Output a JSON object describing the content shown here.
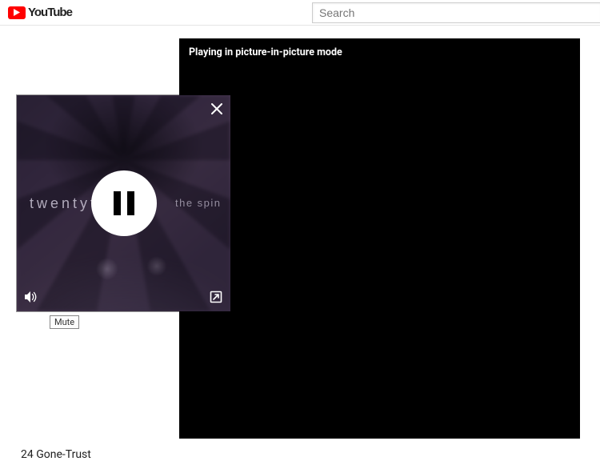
{
  "header": {
    "brand": "YouTube",
    "search_placeholder": "Search"
  },
  "main_player": {
    "message": "Playing in picture-in-picture mode"
  },
  "pip": {
    "album_text_left": "twentyf",
    "album_text_right": "the spin",
    "tooltip_mute": "Mute"
  },
  "video": {
    "title": "24 Gone-Trust"
  }
}
